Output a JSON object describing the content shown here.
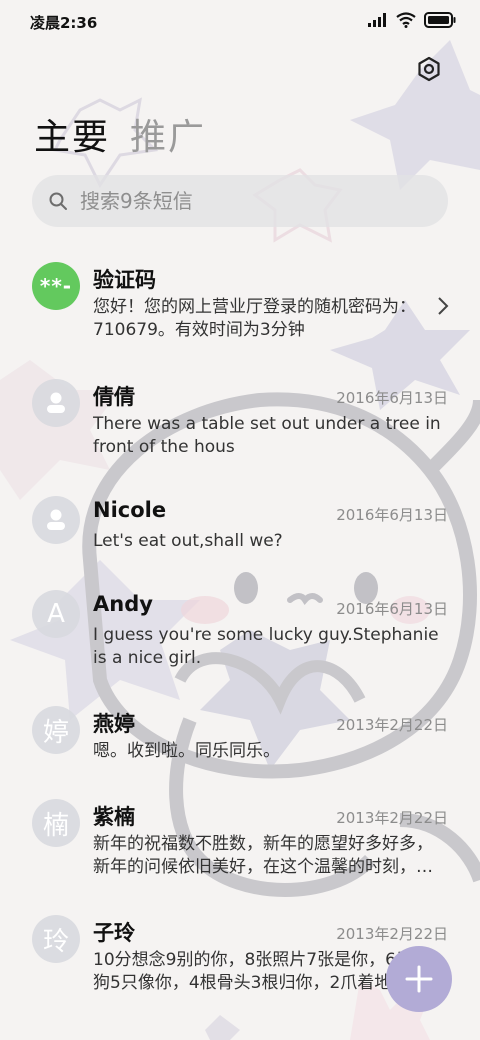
{
  "status": {
    "time": "凌晨2:36"
  },
  "icons": {
    "settings": "gear-icon",
    "search": "search-icon",
    "signal": "signal-icon",
    "wifi": "wifi-icon",
    "battery": "battery-icon",
    "chevron": "chevron-right-icon",
    "compose": "plus-icon",
    "contact": "person-icon"
  },
  "tabs": [
    {
      "label": "主要",
      "active": true
    },
    {
      "label": "推广",
      "active": false
    }
  ],
  "search": {
    "placeholder": "搜索9条短信"
  },
  "conversations": [
    {
      "avatar": "**-",
      "name": "验证码",
      "date": "",
      "preview": "您好！您的网上营业厅登录的随机密码为：710679。有效时间为3分钟"
    },
    {
      "avatar": "",
      "name": "倩倩",
      "date": "2016年6月13日",
      "preview": "There was a table set out under a tree in front of the hous"
    },
    {
      "avatar": "",
      "name": "Nicole",
      "date": "2016年6月13日",
      "preview": "Let's eat out,shall we?"
    },
    {
      "avatar": "A",
      "name": "Andy",
      "date": "2016年6月13日",
      "preview": "I guess you're some lucky guy.Stephanie is a nice girl."
    },
    {
      "avatar": "婷",
      "name": "燕婷",
      "date": "2013年2月22日",
      "preview": "嗯。收到啦。同乐同乐。"
    },
    {
      "avatar": "楠",
      "name": "紫楠",
      "date": "2013年2月22日",
      "preview": "新年的祝福数不胜数，新年的愿望好多好多，新年的问候依旧美好，在这个温馨的时刻，…"
    },
    {
      "avatar": "玲",
      "name": "子玲",
      "date": "2013年2月22日",
      "preview": "10分想念9别的你，8张照片7张是你，6只小狗5只像你，4根骨头3根归你，2爪着地"
    }
  ]
}
